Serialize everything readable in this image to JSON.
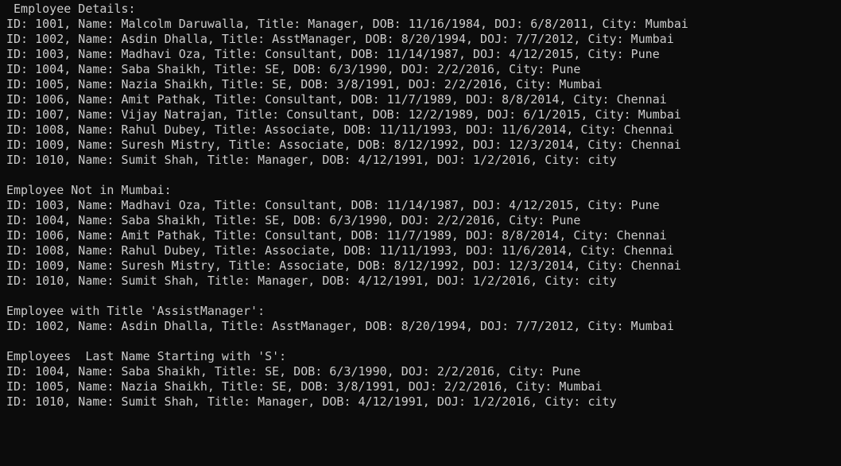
{
  "console": {
    "lines": [
      " Employee Details:",
      "ID: 1001, Name: Malcolm Daruwalla, Title: Manager, DOB: 11/16/1984, DOJ: 6/8/2011, City: Mumbai",
      "ID: 1002, Name: Asdin Dhalla, Title: AsstManager, DOB: 8/20/1994, DOJ: 7/7/2012, City: Mumbai",
      "ID: 1003, Name: Madhavi Oza, Title: Consultant, DOB: 11/14/1987, DOJ: 4/12/2015, City: Pune",
      "ID: 1004, Name: Saba Shaikh, Title: SE, DOB: 6/3/1990, DOJ: 2/2/2016, City: Pune",
      "ID: 1005, Name: Nazia Shaikh, Title: SE, DOB: 3/8/1991, DOJ: 2/2/2016, City: Mumbai",
      "ID: 1006, Name: Amit Pathak, Title: Consultant, DOB: 11/7/1989, DOJ: 8/8/2014, City: Chennai",
      "ID: 1007, Name: Vijay Natrajan, Title: Consultant, DOB: 12/2/1989, DOJ: 6/1/2015, City: Mumbai",
      "ID: 1008, Name: Rahul Dubey, Title: Associate, DOB: 11/11/1993, DOJ: 11/6/2014, City: Chennai",
      "ID: 1009, Name: Suresh Mistry, Title: Associate, DOB: 8/12/1992, DOJ: 12/3/2014, City: Chennai",
      "ID: 1010, Name: Sumit Shah, Title: Manager, DOB: 4/12/1991, DOJ: 1/2/2016, City: city",
      "",
      "Employee Not in Mumbai:",
      "ID: 1003, Name: Madhavi Oza, Title: Consultant, DOB: 11/14/1987, DOJ: 4/12/2015, City: Pune",
      "ID: 1004, Name: Saba Shaikh, Title: SE, DOB: 6/3/1990, DOJ: 2/2/2016, City: Pune",
      "ID: 1006, Name: Amit Pathak, Title: Consultant, DOB: 11/7/1989, DOJ: 8/8/2014, City: Chennai",
      "ID: 1008, Name: Rahul Dubey, Title: Associate, DOB: 11/11/1993, DOJ: 11/6/2014, City: Chennai",
      "ID: 1009, Name: Suresh Mistry, Title: Associate, DOB: 8/12/1992, DOJ: 12/3/2014, City: Chennai",
      "ID: 1010, Name: Sumit Shah, Title: Manager, DOB: 4/12/1991, DOJ: 1/2/2016, City: city",
      "",
      "Employee with Title 'AssistManager':",
      "ID: 1002, Name: Asdin Dhalla, Title: AsstManager, DOB: 8/20/1994, DOJ: 7/7/2012, City: Mumbai",
      "",
      "Employees  Last Name Starting with 'S':",
      "ID: 1004, Name: Saba Shaikh, Title: SE, DOB: 6/3/1990, DOJ: 2/2/2016, City: Pune",
      "ID: 1005, Name: Nazia Shaikh, Title: SE, DOB: 3/8/1991, DOJ: 2/2/2016, City: Mumbai",
      "ID: 1010, Name: Sumit Shah, Title: Manager, DOB: 4/12/1991, DOJ: 1/2/2016, City: city"
    ]
  },
  "colors": {
    "background": "#0c0c0c",
    "text": "#cccccc"
  }
}
